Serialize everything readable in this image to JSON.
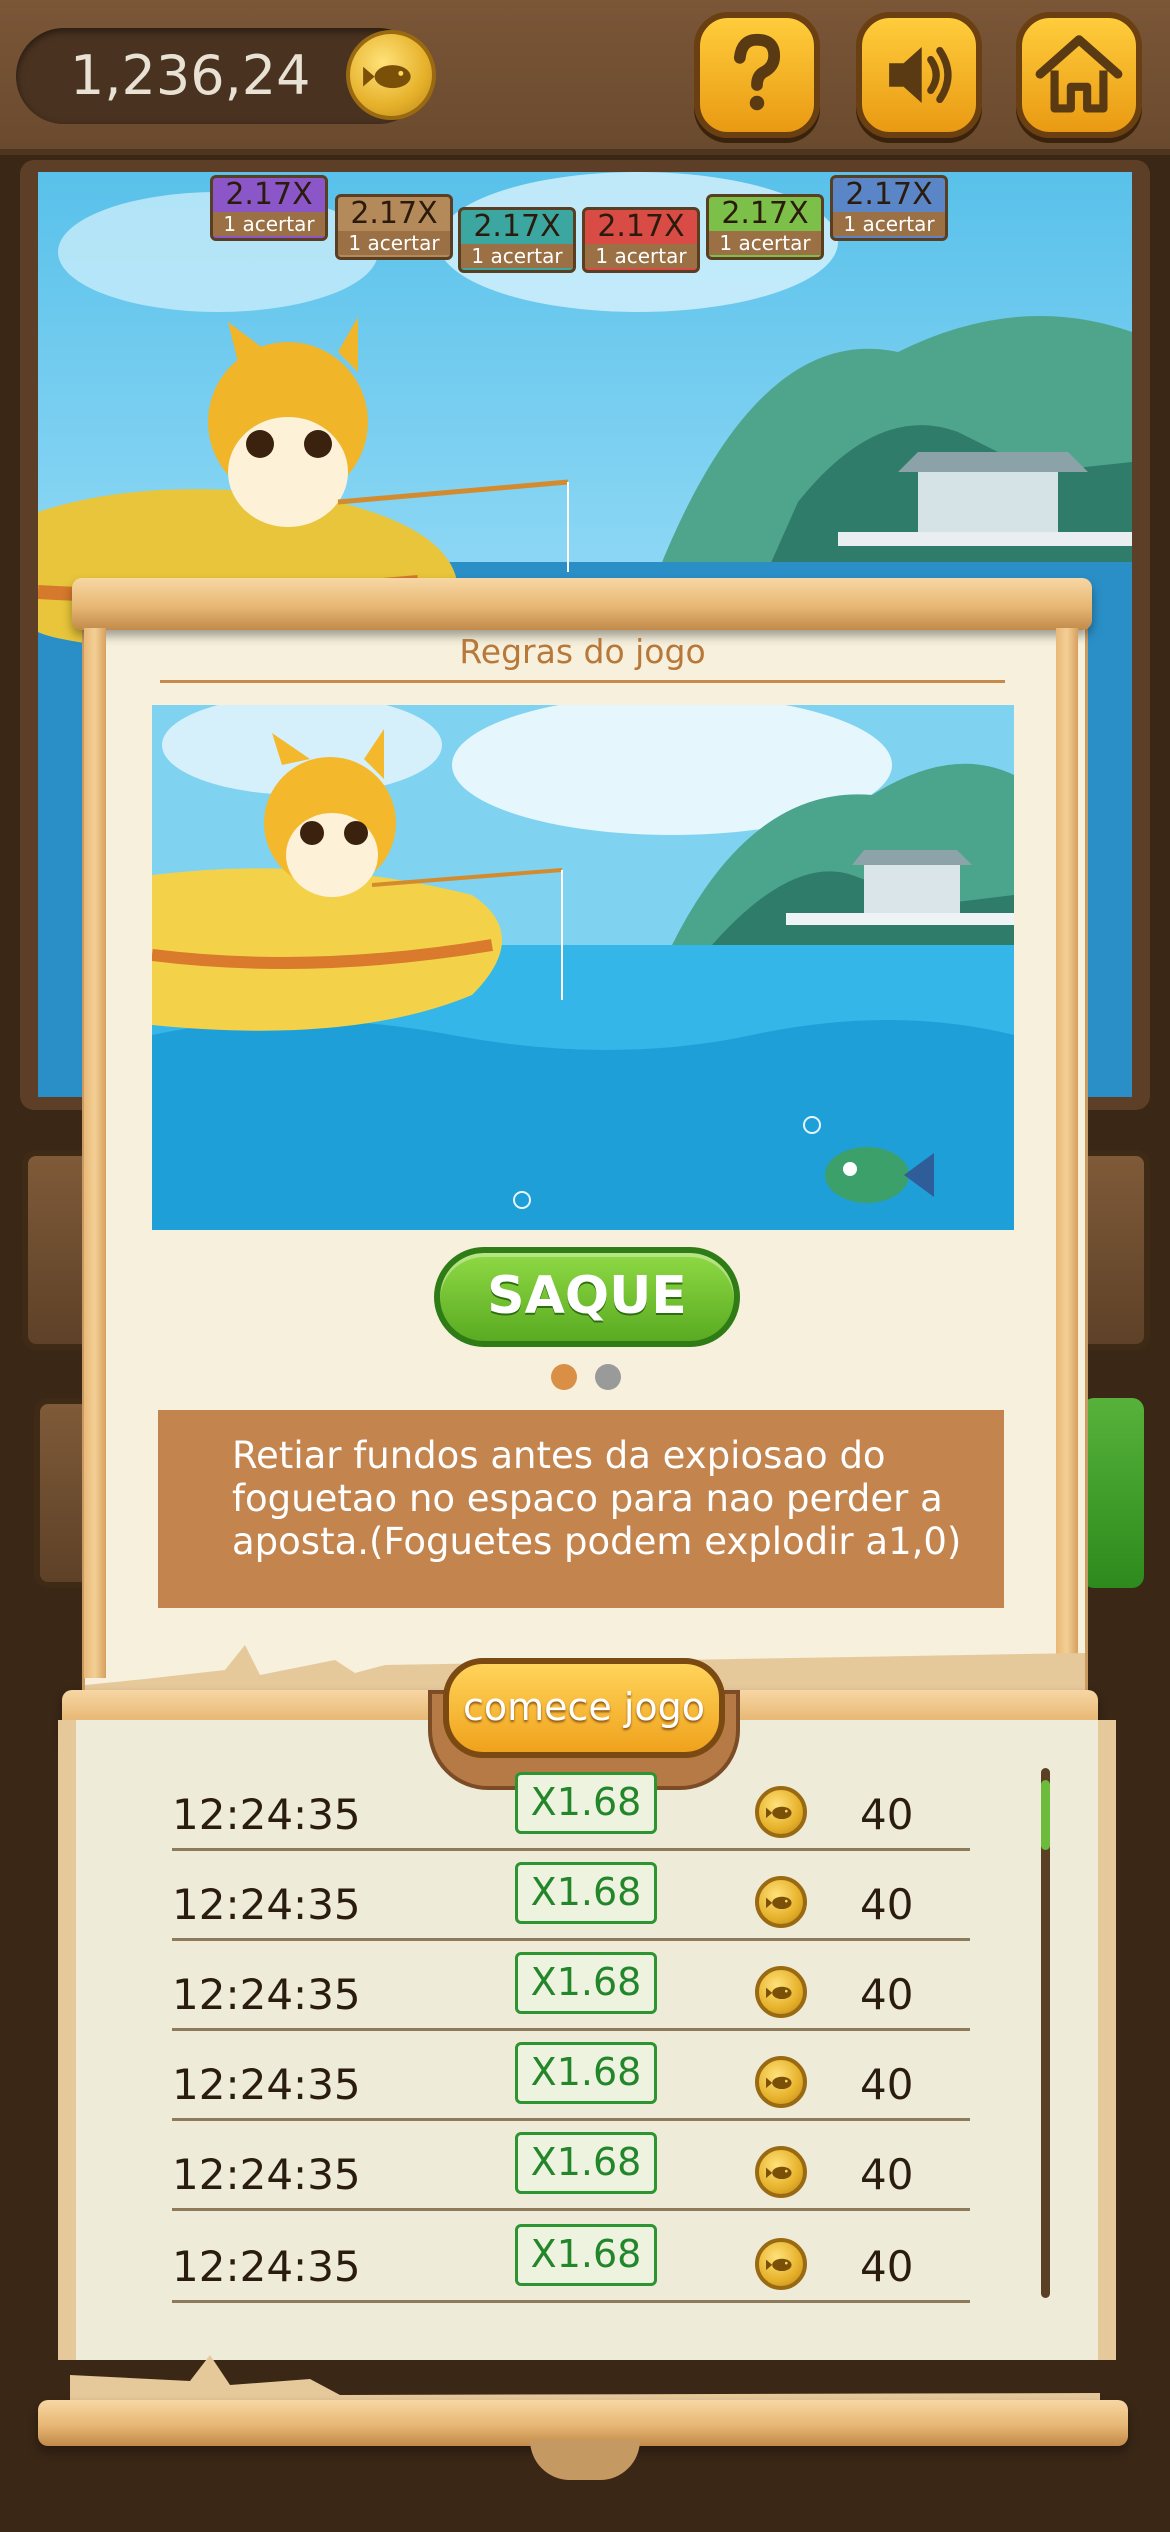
{
  "header": {
    "balance": "1,236,24",
    "help_icon": "question-icon",
    "sound_icon": "speaker-icon",
    "home_icon": "home-icon"
  },
  "multipliers": [
    {
      "value": "2.17X",
      "label": "1 acertar",
      "color": "#8b57c8"
    },
    {
      "value": "2.17X",
      "label": "1 acertar",
      "color": "#b58a5a"
    },
    {
      "value": "2.17X",
      "label": "1 acertar",
      "color": "#3ba7a0"
    },
    {
      "value": "2.17X",
      "label": "1 acertar",
      "color": "#d94b45"
    },
    {
      "value": "2.17X",
      "label": "1 acertar",
      "color": "#7cc04a"
    },
    {
      "value": "2.17X",
      "label": "1 acertar",
      "color": "#5a86c7"
    }
  ],
  "rules": {
    "title": "Regras do jogo",
    "button": "SAQUE",
    "pager": {
      "pages": 2,
      "active": 1,
      "active_color": "#d98f45",
      "inactive_color": "#9a9a9a"
    },
    "description": "Retiar fundos antes da expiosao do foguetao no espaco para nao perder a aposta.(Foguetes podem explodir a1,0)"
  },
  "start_button": "comece jogo",
  "history": [
    {
      "time": "12:24:35",
      "multiplier": "X1.68",
      "amount": "40"
    },
    {
      "time": "12:24:35",
      "multiplier": "X1.68",
      "amount": "40"
    },
    {
      "time": "12:24:35",
      "multiplier": "X1.68",
      "amount": "40"
    },
    {
      "time": "12:24:35",
      "multiplier": "X1.68",
      "amount": "40"
    },
    {
      "time": "12:24:35",
      "multiplier": "X1.68",
      "amount": "40"
    },
    {
      "time": "12:24:35",
      "multiplier": "X1.68",
      "amount": "40"
    }
  ]
}
